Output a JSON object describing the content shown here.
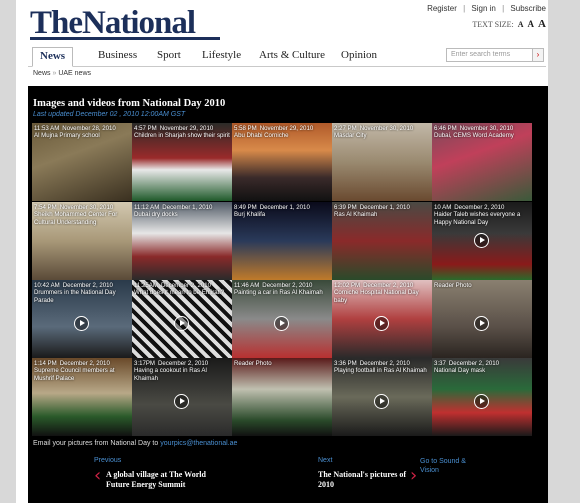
{
  "header": {
    "logo": "TheNational",
    "links": [
      "Register",
      "Sign in",
      "Subscribe"
    ],
    "text_size_label": "TEXT SIZE:",
    "text_size_options": [
      "A",
      "A",
      "A"
    ]
  },
  "nav": {
    "tabs": [
      "News",
      "Business",
      "Sport",
      "Lifestyle",
      "Arts & Culture",
      "Opinion"
    ],
    "active_tab": "News",
    "search_placeholder": "Enter search terms"
  },
  "breadcrumb": [
    "News",
    "UAE news"
  ],
  "gallery": {
    "title": "Images and videos from National Day 2010",
    "updated": "Last updated December 02 , 2010 12:00AM GST",
    "items": [
      {
        "time": "11:53 AM",
        "date": "November 28, 2010",
        "caption": "Al Mujna Primary school",
        "video": false
      },
      {
        "time": "4:57 PM",
        "date": "November 29, 2010",
        "caption": "Children in Sharjah show their spirit",
        "video": false
      },
      {
        "time": "5:58 PM",
        "date": "November 29, 2010",
        "caption": "Abu Dhabi Corniche",
        "video": false
      },
      {
        "time": "2:27 PM",
        "date": "November 30, 2010",
        "caption": "Masdar City",
        "video": false
      },
      {
        "time": "6:46 PM",
        "date": "November 30, 2010",
        "caption": "Dubai, CEMS Word Academy",
        "video": false
      },
      {
        "time": "7:54 PM",
        "date": "November 30, 2010",
        "caption": "Sheikh Mohammed Center For Cultural Understanding",
        "video": false
      },
      {
        "time": "11:12 AM",
        "date": "December 1, 2010",
        "caption": "Dubai dry docks",
        "video": false
      },
      {
        "time": "8:49 PM",
        "date": "December 1, 2010",
        "caption": "Burj Khalifa",
        "video": false
      },
      {
        "time": "6:39 PM",
        "date": "December 1, 2010",
        "caption": "Ras Al Khaimah",
        "video": false
      },
      {
        "time": "10 AM",
        "date": "December 2, 2010",
        "caption": "Haider Taleb wishes everyone a Happy National Day",
        "video": true
      },
      {
        "time": "10:42 AM",
        "date": "December 2, 2010",
        "caption": "Drummers in the National Day Parade",
        "video": true
      },
      {
        "time": "11:25AM",
        "date": "December 2, 2010",
        "caption": "What does it mean to be Emirati?",
        "video": true
      },
      {
        "time": "11:46 AM",
        "date": "December 2, 2010",
        "caption": "Painting a car in Ras Al Khaimah",
        "video": true
      },
      {
        "time": "12:02 PM",
        "date": "December 2, 2010",
        "caption": "Corniche Hospital National Day baby",
        "video": true
      },
      {
        "time": "",
        "date": "",
        "caption": "Reader Photo",
        "video": true
      },
      {
        "time": "1:14 PM",
        "date": "December 2, 2010",
        "caption": "Supreme Council members at Mushrif Palace",
        "video": false
      },
      {
        "time": "3:17PM",
        "date": "December 2, 2010",
        "caption": "Having a cookout in Ras Al Khaimah",
        "video": true
      },
      {
        "time": "",
        "date": "",
        "caption": "Reader Photo",
        "video": false
      },
      {
        "time": "3:36 PM",
        "date": "December 2, 2010",
        "caption": "Playing football in Ras Al Khaimah",
        "video": true
      },
      {
        "time": "3:37",
        "date": "December 2, 2010",
        "caption": "National Day mask",
        "video": true
      }
    ],
    "email_prefix": "Email your pictures from National Day to",
    "email_address": "yourpics@thenational.ae"
  },
  "pager": {
    "previous_label": "Previous",
    "previous_title": "A global village at The World Future Energy Summit",
    "next_label": "Next",
    "next_title": "The National's pictures of 2010",
    "goto_label": "Go to Sound & Vision"
  },
  "colors": {
    "brand": "#1c2f5a",
    "link": "#4a8fd1",
    "accent": "#cc2244"
  }
}
